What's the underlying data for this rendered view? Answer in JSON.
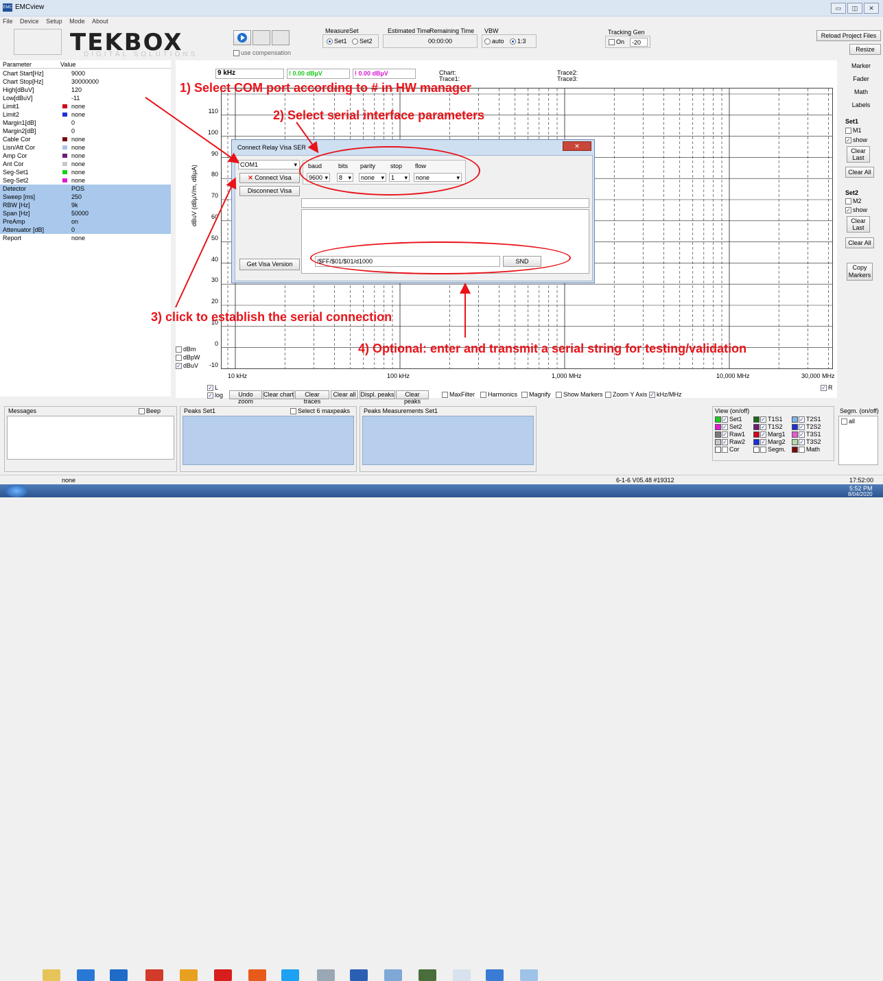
{
  "window": {
    "title": "EMCview",
    "btn_min": "▭",
    "btn_max": "◫",
    "btn_close": "✕"
  },
  "menu": [
    "File",
    "Device",
    "Setup",
    "Mode",
    "About"
  ],
  "logo": {
    "text": "TEKBOX",
    "sub": "DIGITAL SOLUTIONS"
  },
  "toolbar": {
    "use_compensation": "use compensation",
    "measureset_label": "MeasureSet",
    "set1": "Set1",
    "set2": "Set2",
    "est_time_label": "Estimated Time",
    "rem_time_label": "Remaining Time",
    "time_value": "00:00:00",
    "vbw_label": "VBW",
    "vbw_auto": "auto",
    "vbw_ratio": "1:3",
    "tracking_label": "Tracking Gen",
    "tracking_on": "On",
    "tracking_value": "-20",
    "reload": "Reload Project Files",
    "resize": "Resize"
  },
  "params": {
    "header": {
      "name": "Parameter",
      "value": "Value"
    },
    "rows": [
      {
        "name": "Chart Start[Hz]",
        "value": "9000"
      },
      {
        "name": "Chart Stop[Hz]",
        "value": "30000000"
      },
      {
        "name": "High[dBuV]",
        "value": "120"
      },
      {
        "name": "Low[dBuV]",
        "value": "-11"
      },
      {
        "name": "Limit1",
        "value": "none",
        "color": "#d0021b"
      },
      {
        "name": "Limit2",
        "value": "none",
        "color": "#1d2fd6"
      },
      {
        "name": "Margin1[dB]",
        "value": "0"
      },
      {
        "name": "Margin2[dB]",
        "value": "0"
      },
      {
        "name": "Cable Cor",
        "value": "none",
        "color": "#7a0a0a"
      },
      {
        "name": "Lisn/Att Cor",
        "value": "none",
        "color": "#a9c4e6"
      },
      {
        "name": "Amp Cor",
        "value": "none",
        "color": "#6e1b7a"
      },
      {
        "name": "Ant Cor",
        "value": "none",
        "color": "#c8c8c8"
      },
      {
        "name": "Seg-Set1",
        "value": "none",
        "color": "#19d119"
      },
      {
        "name": "Seg-Set2",
        "value": "none",
        "color": "#e01ad6"
      },
      {
        "name": "Detector",
        "value": "POS",
        "blue": true
      },
      {
        "name": "Sweep [ms]",
        "value": "250",
        "blue": true
      },
      {
        "name": "RBW [Hz]",
        "value": "9k",
        "blue": true
      },
      {
        "name": "Span [Hz]",
        "value": "50000",
        "blue": true
      },
      {
        "name": "PreAmp",
        "value": "on",
        "blue": true
      },
      {
        "name": "Attenuator [dB]",
        "value": "0",
        "blue": true
      },
      {
        "name": "Report",
        "value": "none"
      }
    ]
  },
  "chart_info": {
    "freq": "9 kHz",
    "val1": "! 0.00 dBµV",
    "val2": "! 0.00 dBµV",
    "chart_label": "Chart:",
    "trace1": "Trace1:",
    "trace2": "Trace2:",
    "trace3": "Trace3:"
  },
  "chart_data": {
    "type": "line",
    "ylabel": "dBuV  (dBµV/m, dBµA)",
    "yticks": [
      "110",
      "100",
      "90",
      "80",
      "70",
      "60",
      "50",
      "40",
      "30",
      "20",
      "10",
      "0",
      "-10"
    ],
    "xticks": [
      "10 kHz",
      "100 kHz",
      "1,000 MHz",
      "10,000 MHz",
      "30,000 MHz"
    ],
    "x_scale": "log",
    "ylim": [
      -11,
      120
    ]
  },
  "units": [
    "dBm",
    "dBpW",
    "dBuV"
  ],
  "chart_controls": {
    "L": "L",
    "log": "log",
    "undo_zoom": "Undo zoom",
    "clear_chart": "Clear chart",
    "clear_traces": "Clear traces",
    "clear_all": "Clear all",
    "displ_peaks": "Displ. peaks",
    "clear_peaks": "Clear peaks",
    "maxfilter": "MaxFilter",
    "harmonics": "Harmonics",
    "magnify": "Magnify",
    "show_markers": "Show Markers",
    "zoom_y": "Zoom Y Axis",
    "khz_mhz": "kHz/MHz",
    "R": "R"
  },
  "right_panel": {
    "marker": "Marker",
    "fader": "Fader",
    "math": "Math",
    "labels": "Labels",
    "set1": "Set1",
    "m1": "M1",
    "show": "show",
    "clear_last": "Clear Last",
    "clear_all": "Clear All",
    "set2": "Set2",
    "m2": "M2",
    "copy_markers": "Copy Markers"
  },
  "dialog": {
    "title": "Connect Relay Visa SER",
    "com": "COM1",
    "connect": "Connect Visa",
    "disconnect": "Disconnect Visa",
    "get_version": "Get Visa Version",
    "headers": [
      "baud",
      "bits",
      "parity",
      "stop",
      "flow"
    ],
    "values": [
      "9600",
      "8",
      "none",
      "1",
      "none"
    ],
    "send_string": "/$FF/$01/$01/d1000",
    "snd": "SND"
  },
  "annotations": {
    "a1": "1) Select COM port according to # in HW manager",
    "a2": "2) Select serial interface parameters",
    "a3": "3) click to establish the serial connection",
    "a4": "4) Optional: enter and transmit a serial string for testing/validation"
  },
  "bottom": {
    "messages": "Messages",
    "beep": "Beep",
    "peaks_set1": "Peaks Set1",
    "select6": "Select 6 maxpeaks",
    "peaks_meas": "Peaks Measurements Set1",
    "view": "View (on/off)",
    "segm": "Segm. (on/off)",
    "all": "all",
    "view_items": [
      [
        "Set1",
        "T1S1",
        "T2S1"
      ],
      [
        "Set2",
        "T1S2",
        "T2S2"
      ],
      [
        "Raw1",
        "Marg1",
        "T3S1"
      ],
      [
        "Raw2",
        "Marg2",
        "T3S2"
      ],
      [
        "Cor",
        "Segm.",
        "Math"
      ]
    ]
  },
  "status": {
    "left": "none",
    "version": "6-1-6 V05.48 #19312",
    "time": "17:52:00"
  },
  "taskbar": {
    "time": "5:52 PM",
    "date": "8/04/2020"
  }
}
